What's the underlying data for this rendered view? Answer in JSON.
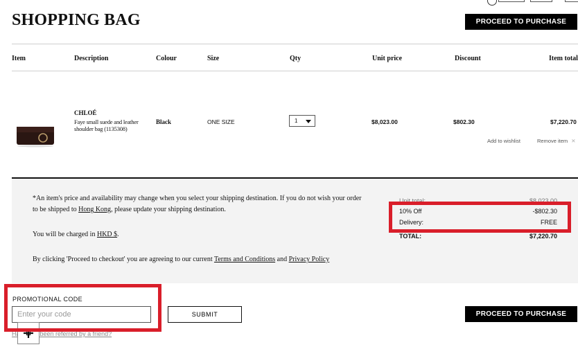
{
  "header": {
    "title": "SHOPPING BAG",
    "proceed_label": "PROCEED TO PURCHASE"
  },
  "table": {
    "columns": [
      "Item",
      "Description",
      "Colour",
      "Size",
      "Qty",
      "Unit price",
      "Discount",
      "Item total"
    ]
  },
  "item": {
    "brand": "CHLOÉ",
    "description": "Faye small suede and leather shoulder bag (1135308)",
    "colour": "Black",
    "size": "ONE SIZE",
    "qty": "1",
    "unit_price": "$8,023.00",
    "discount": "$802.30",
    "item_total": "$7,220.70",
    "add_to_wishlist": "Add to wishlist",
    "remove_item": "Remove item",
    "remove_icon": "close-icon"
  },
  "notes": {
    "availability_part1": "*An item's price and availability may change when you select your shipping destination. If you do not wish your order",
    "availability_part2": "to be shipped to",
    "destination": "Hong Kong",
    "availability_part3": ", please update your shipping destination.",
    "charged_prefix": "You will be charged in",
    "currency": "HKD $",
    "charged_suffix": ".",
    "agree_prefix": "By clicking 'Proceed to checkout' you are agreeing to our current",
    "terms": "Terms and Conditions",
    "and": "and",
    "privacy": "Privacy Policy"
  },
  "summary": {
    "unit_total_label": "Unit total:",
    "unit_total_value": "$8,023.00",
    "discount_label": "10% Off",
    "discount_value": "-$802.30",
    "delivery_label": "Delivery:",
    "delivery_value": "FREE",
    "total_label": "TOTAL:",
    "total_value": "$7,220.70"
  },
  "promo": {
    "label": "PROMOTIONAL CODE",
    "placeholder": "Enter your code",
    "submit_label": "SUBMIT",
    "referral_link": "Have you been referred by a friend?"
  },
  "footer": {
    "proceed_label": "PROCEED TO PURCHASE"
  },
  "colors": {
    "highlight": "#d91e2a",
    "button": "#000000",
    "panel": "#f3f3f3"
  }
}
